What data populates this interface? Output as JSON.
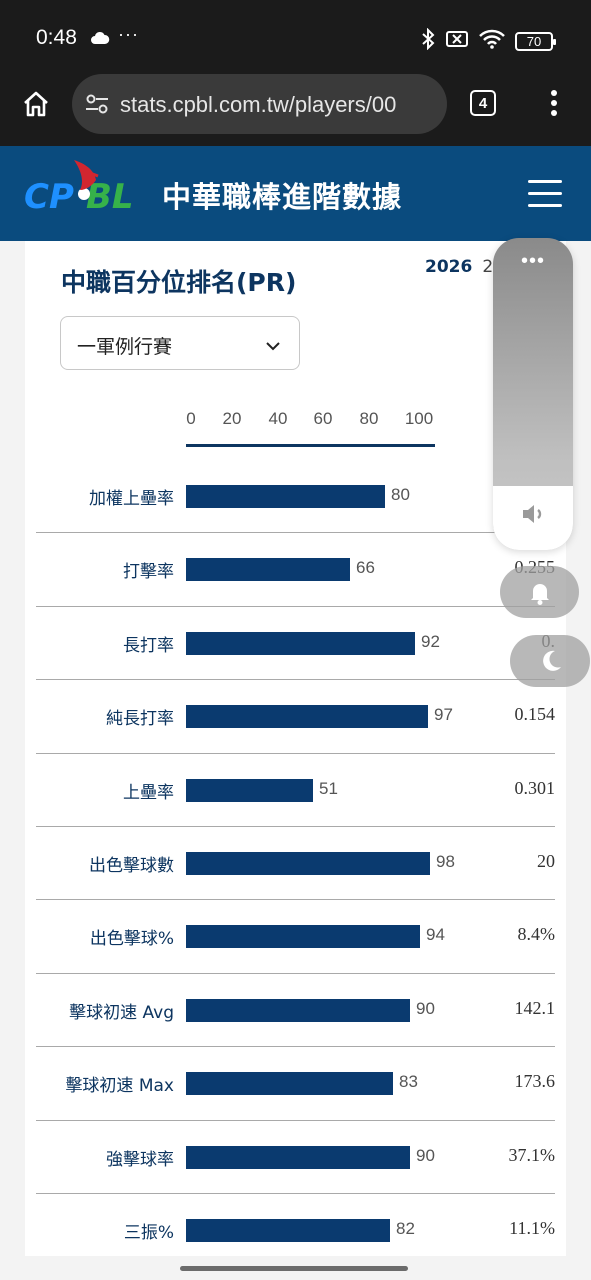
{
  "status_bar": {
    "time": "0:48",
    "overflow": "···",
    "battery": "70",
    "icons": [
      "cloud-icon",
      "bluetooth-icon",
      "no-sim-icon",
      "wifi-icon",
      "battery-icon"
    ]
  },
  "browser": {
    "url": "stats.cpbl.com.tw/players/00",
    "tab_count": "4",
    "icons": [
      "home-icon",
      "site-settings-icon",
      "tabs-icon",
      "more-vert-icon"
    ]
  },
  "site": {
    "title": "中華職棒進階數據",
    "logo_text": "CPBL",
    "brand_color": "#0a4b7e"
  },
  "card": {
    "title": "中職百分位排名(PR)",
    "years": [
      "2026",
      "28"
    ],
    "dropdown_label": "一軍例行賽",
    "axis_ticks": [
      "0",
      "20",
      "40",
      "60",
      "80",
      "100"
    ],
    "bar_color": "#0a3a6f"
  },
  "rows": [
    {
      "label": "加權上壘率",
      "pr": 80,
      "pr_text": "80",
      "value": ""
    },
    {
      "label": "打擊率",
      "pr": 66,
      "pr_text": "66",
      "value": "0.255"
    },
    {
      "label": "長打率",
      "pr": 92,
      "pr_text": "92",
      "value": "0."
    },
    {
      "label": "純長打率",
      "pr": 97,
      "pr_text": "97",
      "value": "0.154"
    },
    {
      "label": "上壘率",
      "pr": 51,
      "pr_text": "51",
      "value": "0.301"
    },
    {
      "label": "出色擊球數",
      "pr": 98,
      "pr_text": "98",
      "value": "20"
    },
    {
      "label": "出色擊球%",
      "pr": 94,
      "pr_text": "94",
      "value": "8.4%"
    },
    {
      "label": "擊球初速 Avg",
      "pr": 90,
      "pr_text": "90",
      "value": "142.1"
    },
    {
      "label": "擊球初速 Max",
      "pr": 83,
      "pr_text": "83",
      "value": "173.6"
    },
    {
      "label": "強擊球率",
      "pr": 90,
      "pr_text": "90",
      "value": "37.1%"
    },
    {
      "label": "三振%",
      "pr": 82,
      "pr_text": "82",
      "value": "11.1%"
    }
  ],
  "overlay": {
    "dots": "•••",
    "icons": [
      "volume-icon",
      "bell-icon",
      "moon-icon"
    ]
  }
}
